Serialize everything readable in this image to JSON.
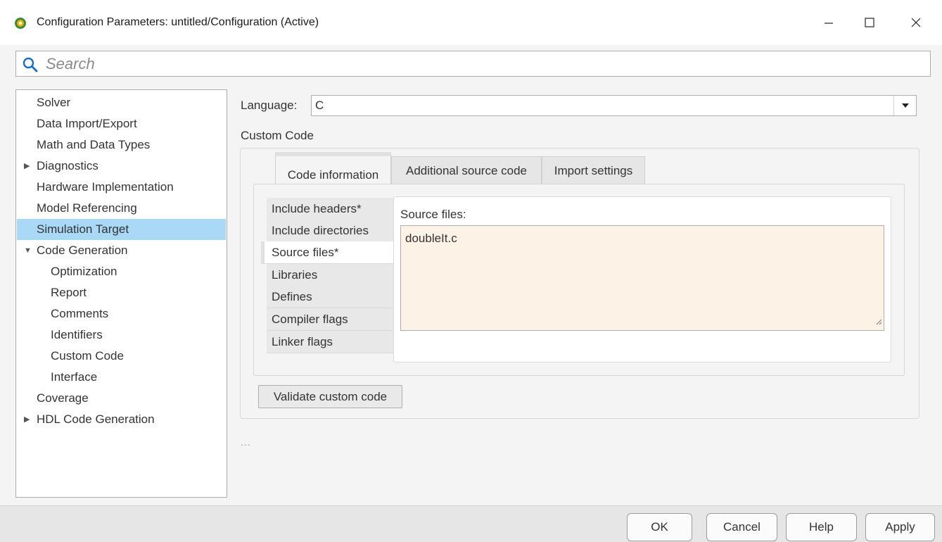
{
  "window": {
    "title": "Configuration Parameters: untitled/Configuration (Active)",
    "app_icon": "simulink-gear-icon"
  },
  "search": {
    "placeholder": "Search",
    "value": ""
  },
  "tree": {
    "items": [
      {
        "label": "Solver"
      },
      {
        "label": "Data Import/Export"
      },
      {
        "label": "Math and Data Types"
      },
      {
        "label": "Diagnostics",
        "expander": "collapsed"
      },
      {
        "label": "Hardware Implementation"
      },
      {
        "label": "Model Referencing"
      },
      {
        "label": "Simulation Target",
        "selected": true
      },
      {
        "label": "Code Generation",
        "expander": "expanded"
      },
      {
        "label": "Optimization"
      },
      {
        "label": "Report"
      },
      {
        "label": "Comments"
      },
      {
        "label": "Identifiers"
      },
      {
        "label": "Custom Code"
      },
      {
        "label": "Interface"
      },
      {
        "label": "Coverage"
      },
      {
        "label": "HDL Code Generation",
        "expander": "collapsed"
      }
    ]
  },
  "main": {
    "language_label": "Language:",
    "language_value": "C",
    "section_title": "Custom Code",
    "tabs": [
      {
        "label": "Code information",
        "active": true
      },
      {
        "label": "Additional source code"
      },
      {
        "label": "Import settings"
      }
    ],
    "side_tabs": [
      {
        "label": "Include headers*"
      },
      {
        "label": "Include directories"
      },
      {
        "label": "Source files*",
        "active": true
      },
      {
        "label": "Libraries"
      },
      {
        "label": "Defines"
      },
      {
        "label": "Compiler flags"
      },
      {
        "label": "Linker flags"
      }
    ],
    "field_label": "Source files:",
    "field_value": "doubleIt.c",
    "field_bg": "#fdf2e6",
    "validate_label": "Validate custom code",
    "ellipsis": "..."
  },
  "footer": {
    "ok": "OK",
    "cancel": "Cancel",
    "help": "Help",
    "apply": "Apply"
  },
  "colors": {
    "selection": "#a9d9f7",
    "accent": "#1a6fc4"
  }
}
